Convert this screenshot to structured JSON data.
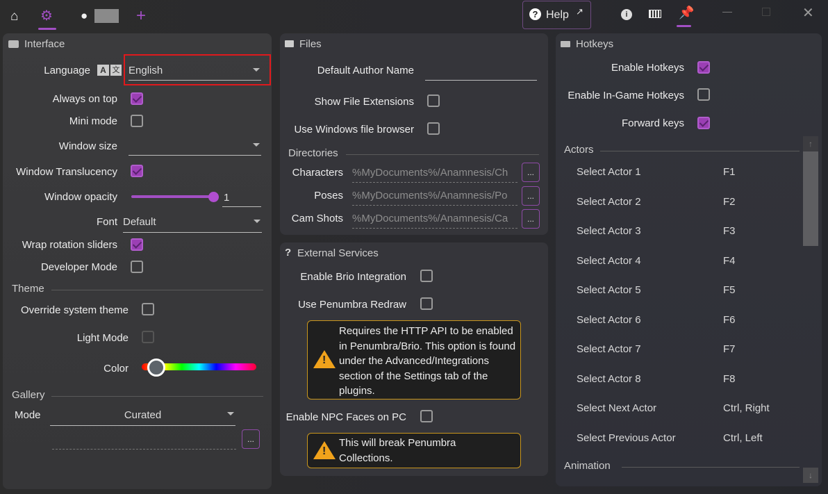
{
  "titlebar": {
    "help_label": "Help",
    "active_tab": "settings",
    "active_right": "pin",
    "accent": "#a24fc4"
  },
  "interface": {
    "title": "Interface",
    "language_label": "Language",
    "language_value": "English",
    "always_on_top_label": "Always on top",
    "always_on_top": true,
    "mini_mode_label": "Mini mode",
    "mini_mode": false,
    "window_size_label": "Window size",
    "window_size_value": "",
    "translucency_label": "Window Translucency",
    "translucency": true,
    "opacity_label": "Window opacity",
    "opacity_value": "1",
    "opacity_fraction": 1,
    "font_label": "Font",
    "font_value": "Default",
    "wrap_label": "Wrap rotation sliders",
    "wrap": true,
    "dev_label": "Developer Mode",
    "dev": false,
    "theme_header": "Theme",
    "override_label": "Override system theme",
    "override": false,
    "light_label": "Light Mode",
    "light": false,
    "color_label": "Color",
    "gallery_header": "Gallery",
    "mode_label": "Mode",
    "mode_value": "Curated",
    "gallery_path": "",
    "browse": "..."
  },
  "files": {
    "title": "Files",
    "author_label": "Default Author Name",
    "author_value": "",
    "ext_label": "Show File Extensions",
    "ext": false,
    "winbrowser_label": "Use Windows file browser",
    "winbrowser": false,
    "dirs_header": "Directories",
    "dirs": [
      {
        "label": "Characters",
        "value": "%MyDocuments%/Anamnesis/Ch"
      },
      {
        "label": "Poses",
        "value": "%MyDocuments%/Anamnesis/Po"
      },
      {
        "label": "Cam Shots",
        "value": "%MyDocuments%/Anamnesis/Ca"
      }
    ],
    "browse": "..."
  },
  "external": {
    "title": "External Services",
    "brio_label": "Enable Brio Integration",
    "brio": false,
    "penumbra_label": "Use Penumbra Redraw",
    "penumbra": false,
    "warning1": "Requires the HTTP API to be enabled in Penumbra/Brio. This option is found under the Advanced/Integrations section of the Settings tab of the plugins.",
    "npc_label": "Enable NPC Faces on PC",
    "npc": false,
    "warning2": "This will break Penumbra Collections."
  },
  "hotkeys": {
    "title": "Hotkeys",
    "enable_label": "Enable Hotkeys",
    "enable": true,
    "ingame_label": "Enable In-Game Hotkeys",
    "ingame": false,
    "forward_label": "Forward keys",
    "forward": true,
    "actors_header": "Actors",
    "items": [
      {
        "name": "Select Actor 1",
        "key": "F1"
      },
      {
        "name": "Select Actor 2",
        "key": "F2"
      },
      {
        "name": "Select Actor 3",
        "key": "F3"
      },
      {
        "name": "Select Actor 4",
        "key": "F4"
      },
      {
        "name": "Select Actor 5",
        "key": "F5"
      },
      {
        "name": "Select Actor 6",
        "key": "F6"
      },
      {
        "name": "Select Actor 7",
        "key": "F7"
      },
      {
        "name": "Select Actor 8",
        "key": "F8"
      },
      {
        "name": "Select Next Actor",
        "key": "Ctrl, Right"
      },
      {
        "name": "Select Previous Actor",
        "key": "Ctrl, Left"
      }
    ],
    "animation_header": "Animation"
  }
}
